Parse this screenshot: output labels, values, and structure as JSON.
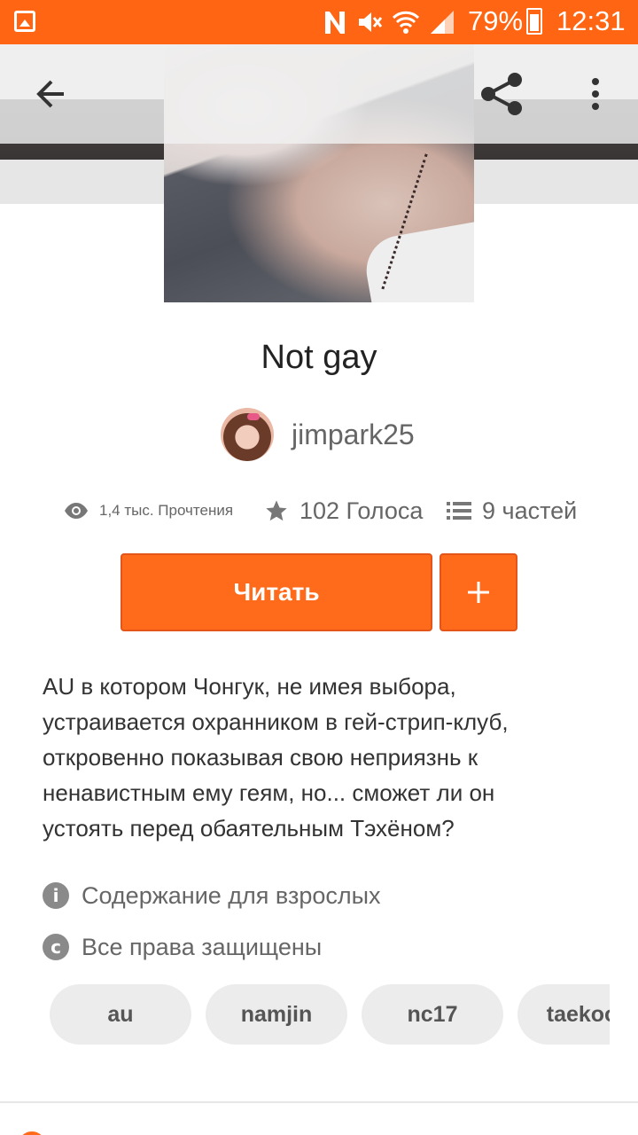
{
  "status_bar": {
    "battery_percent": "79%",
    "time": "12:31",
    "icons": [
      "image-icon",
      "n-icon",
      "mute-icon",
      "wifi-icon",
      "signal-icon",
      "battery-icon"
    ]
  },
  "toolbar": {
    "icons": [
      "back-arrow-icon",
      "share-icon",
      "more-vert-icon"
    ]
  },
  "story": {
    "title": "Not gay",
    "author": "jimpark25",
    "stats": {
      "reads": "1,4 тыс. Прочтения",
      "votes": "102 Голоса",
      "parts": "9 частей"
    },
    "read_button": "Читать",
    "add_button": "+",
    "description_lines": [
      "AU в котором Чонгук, не имея выбора,",
      "устраивается охранником в гей-стрип-клуб,",
      "откровенно показывая свою неприязнь к",
      "ненавистным ему геям, но... сможет ли он",
      "устоять перед обаятельным Тэхёном?"
    ],
    "mature": "Содержание для взрослых",
    "copyright": "Все права защищены",
    "tags": [
      "au",
      "namjin",
      "nc17",
      "taekook"
    ]
  },
  "colors": {
    "accent": "#ff6a1b",
    "status_bar": "#ff6512",
    "tag_bg": "#ececec",
    "muted_text": "#666666"
  }
}
